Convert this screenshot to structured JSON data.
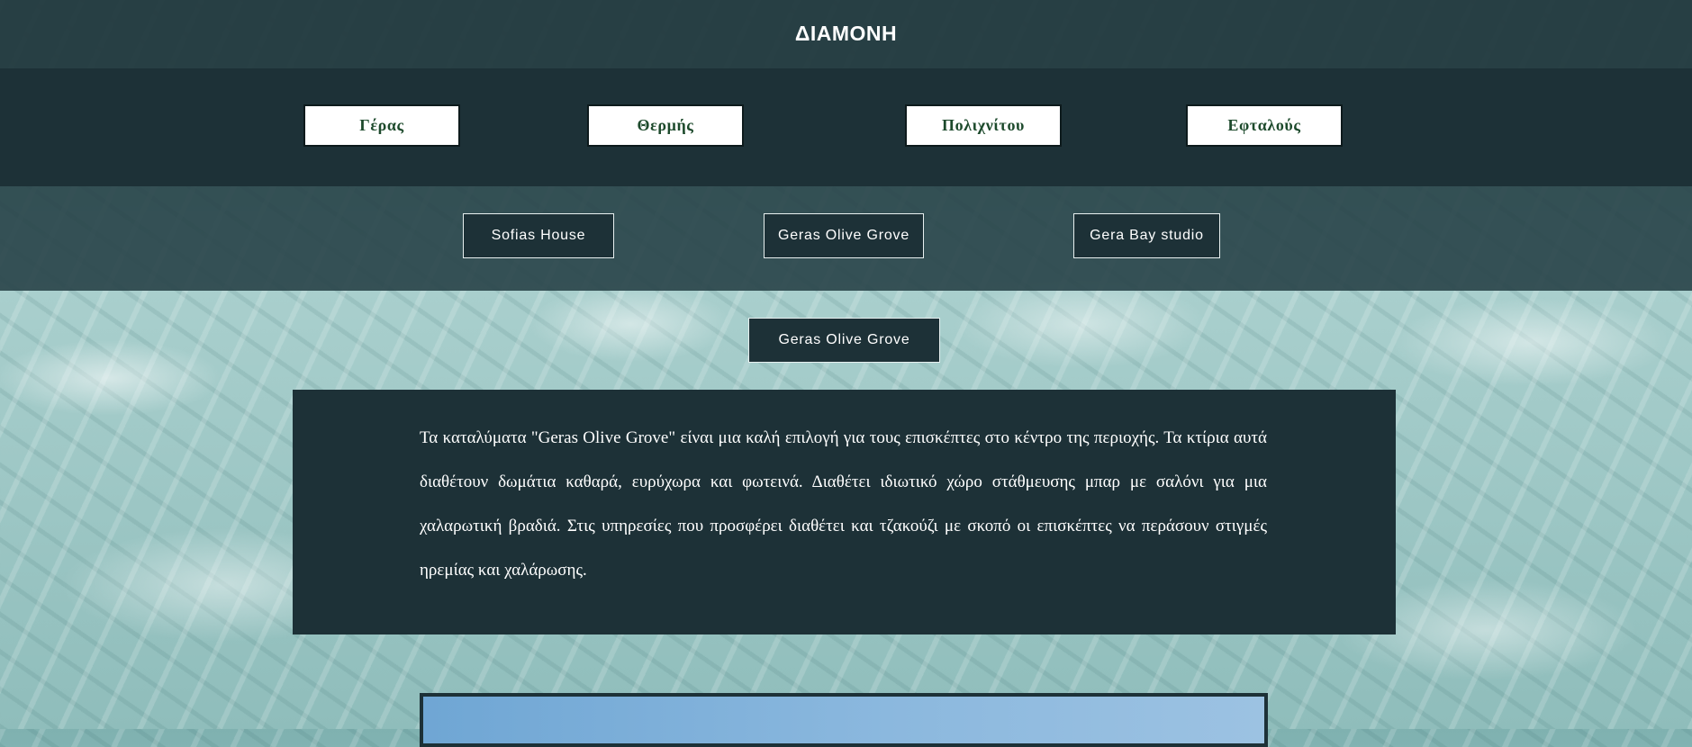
{
  "header": {
    "title": "ΔΙΑΜΟΝΗ"
  },
  "area_nav": [
    {
      "label": "Γέρας"
    },
    {
      "label": "Θερμής"
    },
    {
      "label": "Πολιχνίτου"
    },
    {
      "label": "Εφταλούς"
    }
  ],
  "accommodation_nav": [
    {
      "label": "Sofias House"
    },
    {
      "label": "Geras Olive Grove"
    },
    {
      "label": "Gera Bay studio"
    }
  ],
  "selected": {
    "label": "Geras Olive Grove"
  },
  "description": {
    "text": "Τα καταλύματα \"Geras Olive Grove\" είναι μια καλή επιλογή για τους επισκέπτες στο κέντρο της περιοχής. Τα κτίρια αυτά διαθέτουν δωμάτια καθαρά, ευρύχωρα και φωτεινά. Διαθέτει ιδιωτικό χώρο στάθμευσης μπαρ με σαλόνι για μια χαλαρωτική βραδιά. Στις υπηρεσίες που προσφέρει διαθέτει και τζακούζι με σκοπό οι επισκέπτες να περάσουν στιγμές ηρεμίας και χαλάρωσης."
  },
  "colors": {
    "dark_teal": "#1d3137",
    "header_bg": "#233a40",
    "nav_text_green": "#1d4a2c",
    "water": "#a9cfcd"
  }
}
